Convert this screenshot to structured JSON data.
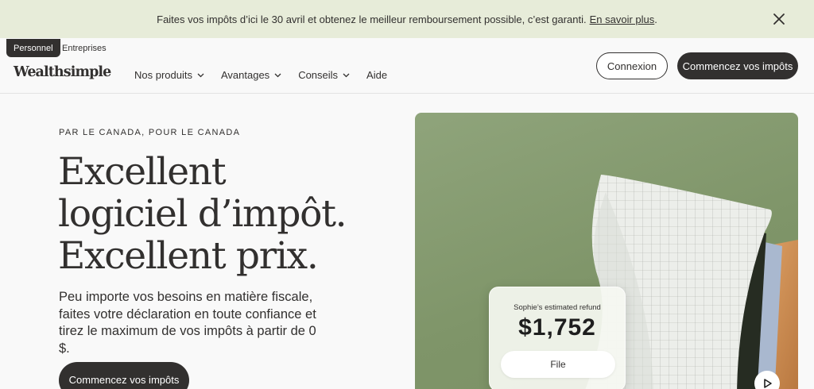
{
  "banner": {
    "text": "Faites vos impôts d’ici le 30 avril et obtenez le meilleur remboursement possible, c’est garanti.",
    "link_label": "En savoir plus",
    "link_suffix": "."
  },
  "header": {
    "segments": [
      "Personnel",
      "Entreprises"
    ],
    "logo": "Wealthsimple",
    "nav": [
      {
        "label": "Nos produits",
        "dropdown": true
      },
      {
        "label": "Avantages",
        "dropdown": true
      },
      {
        "label": "Conseils",
        "dropdown": true
      },
      {
        "label": "Aide",
        "dropdown": false
      }
    ],
    "login_label": "Connexion",
    "cta_label": "Commencez vos impôts"
  },
  "hero": {
    "eyebrow": "PAR LE CANADA, POUR LE CANADA",
    "headline": [
      "Excellent",
      "logiciel d’impôt.",
      "Excellent prix."
    ],
    "subtext": "Peu importe vos besoins en matière fiscale, faites votre déclaration en toute confiance et tirez le maximum de vos impôts à partir de 0 $.",
    "cta_label": "Commencez vos impôts"
  },
  "media": {
    "refund_label": "Sophie’s estimated refund",
    "refund_amount": "$1,752",
    "file_label": "File"
  },
  "colors": {
    "banner_bg": "#e7ecd9",
    "dark": "#32302f",
    "media_bg": "#8fa47b"
  },
  "icons": [
    "close-icon",
    "chevron-down-icon",
    "play-icon"
  ]
}
